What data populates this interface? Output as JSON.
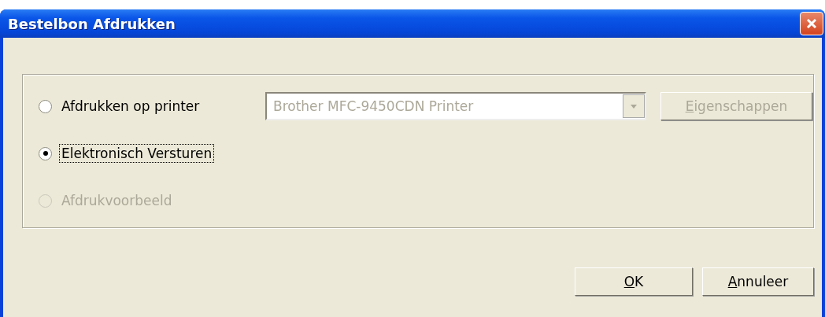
{
  "window": {
    "title": "Bestelbon Afdrukken"
  },
  "options": [
    {
      "label": "Afdrukken op printer",
      "selected": false,
      "disabled": false,
      "focused": false
    },
    {
      "label": "Elektronisch Versturen",
      "selected": true,
      "disabled": false,
      "focused": true
    },
    {
      "label": "Afdrukvoorbeeld",
      "selected": false,
      "disabled": true,
      "focused": false
    }
  ],
  "printer_select": {
    "value": "Brother MFC-9450CDN Printer",
    "disabled": true
  },
  "properties_button": {
    "label": "Eigenschappen",
    "disabled": true,
    "access_key_underlined": true
  },
  "buttons": [
    {
      "label": "OK",
      "disabled": false,
      "access_key_underlined": true
    },
    {
      "label": "Annuleer",
      "disabled": false,
      "access_key_underlined": true
    }
  ]
}
